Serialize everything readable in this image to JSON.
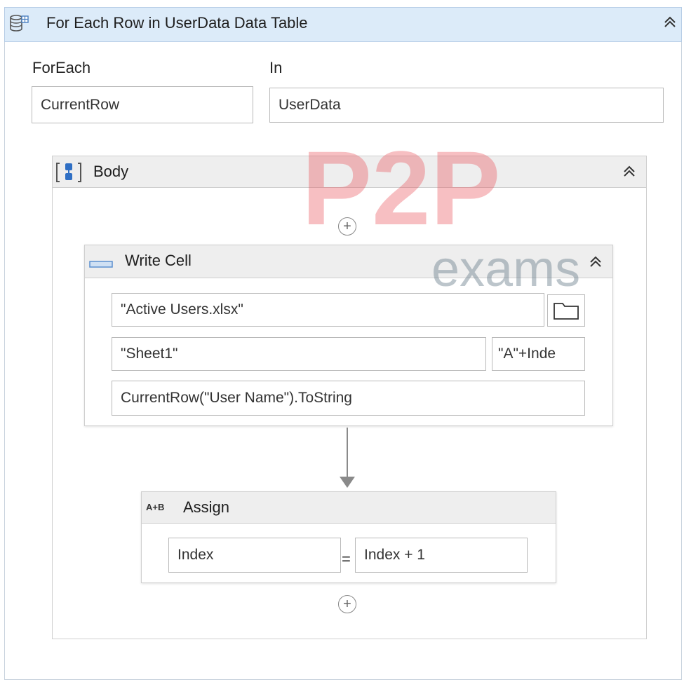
{
  "foreach": {
    "title": "For Each Row in UserData Data Table",
    "item_label": "ForEach",
    "item_value": "CurrentRow",
    "in_label": "In",
    "in_value": "UserData",
    "collapse_icon": "double-chevron-up-icon",
    "icon": "datatable-icon"
  },
  "body": {
    "title": "Body",
    "icon": "sequence-icon",
    "collapse_icon": "double-chevron-up-icon",
    "add_icon": "plus-circle-icon"
  },
  "write_cell": {
    "title": "Write Cell",
    "icon": "write-cell-icon",
    "workbook_path": "\"Active Users.xlsx\"",
    "sheet_name": "\"Sheet1\"",
    "range": "\"A\"+Inde",
    "value": "CurrentRow(\"User Name\").ToString",
    "browse_icon": "folder-icon",
    "collapse_icon": "double-chevron-up-icon"
  },
  "assign": {
    "title": "Assign",
    "icon_text": "A+B",
    "to": "Index",
    "equals": "=",
    "value": "Index + 1"
  },
  "watermark": {
    "logo_text": "P2P",
    "sub_text": "exams",
    "colors": {
      "red": "#e8484f",
      "gray": "#6b7f8c"
    }
  }
}
